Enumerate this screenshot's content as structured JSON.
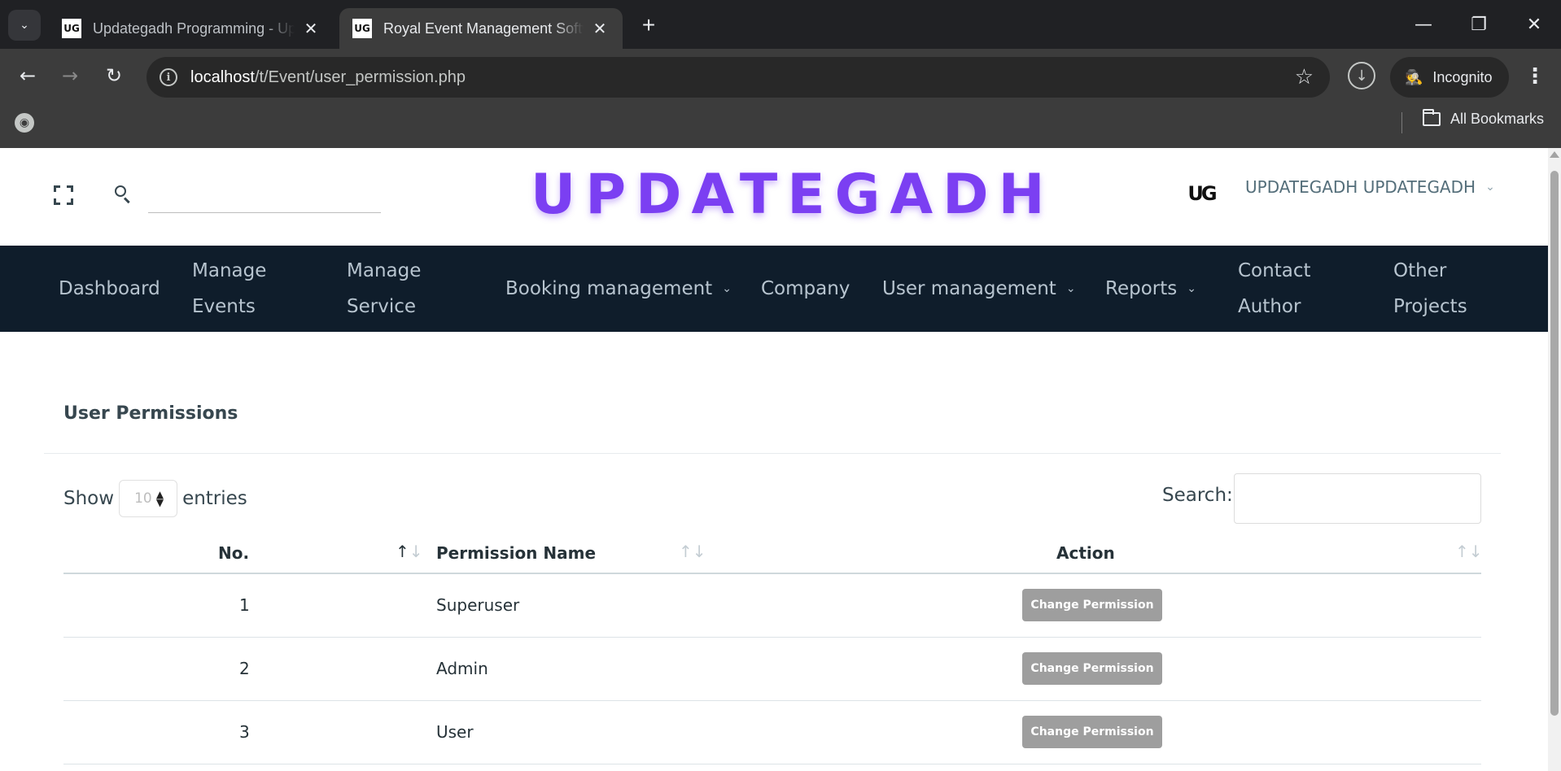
{
  "browser": {
    "tabs": [
      {
        "title": "Updategadh Programming - Updategadh",
        "favicon": "UG",
        "active": false
      },
      {
        "title": "Royal Event Management Software",
        "favicon": "UG",
        "active": true
      }
    ],
    "url_host": "localhost",
    "url_path": "/t/Event/user_permission.php",
    "incognito_label": "Incognito",
    "all_bookmarks_label": "All Bookmarks"
  },
  "header": {
    "brand": "UPDATEGADH",
    "search_placeholder": "",
    "avatar_text": "UG",
    "user_name": "UPDATEGADH UPDATEGADH"
  },
  "nav": {
    "items": [
      {
        "label": "Dashboard"
      },
      {
        "line1": "Manage",
        "line2": "Events"
      },
      {
        "line1": "Manage",
        "line2": "Service"
      },
      {
        "label": "Booking management"
      },
      {
        "label": "Company"
      },
      {
        "label": "User management"
      },
      {
        "label": "Reports"
      },
      {
        "line1": "Contact",
        "line2": "Author"
      },
      {
        "line1": "Other",
        "line2": "Projects"
      }
    ]
  },
  "card": {
    "title": "User Permissions",
    "show_label": "Show",
    "entries_value": "10",
    "entries_label": "entries",
    "search_label": "Search:"
  },
  "table": {
    "columns": [
      "No.",
      "Permission Name",
      "Action"
    ],
    "rows": [
      {
        "no": "1",
        "name": "Superuser",
        "action": "Change Permission"
      },
      {
        "no": "2",
        "name": "Admin",
        "action": "Change Permission"
      },
      {
        "no": "3",
        "name": "User",
        "action": "Change Permission"
      }
    ]
  },
  "colors": {
    "brand": "#7b3ff2",
    "navbar_bg": "#0f1d2b",
    "button_bg": "#9e9e9e"
  },
  "icons": {
    "fullscreen": "fullscreen-icon",
    "search": "search-icon",
    "sort": "sort-icon",
    "dropdown": "chevron-down-icon"
  }
}
